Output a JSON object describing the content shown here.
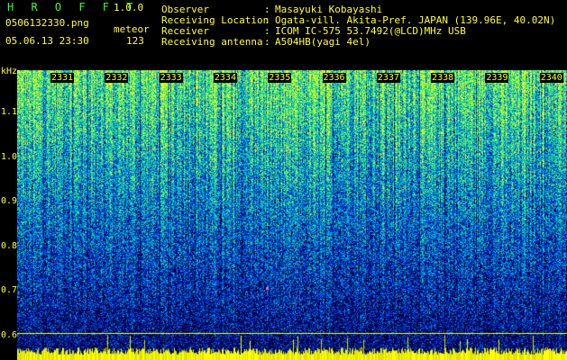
{
  "header": {
    "app_title": "H R O F F T",
    "app_version": "1.0.0",
    "file_name": "0506132330.png",
    "mode": "meteor",
    "date_time": "05.06.13 23:30",
    "count": "123"
  },
  "info": [
    {
      "key": "Observer",
      "value": "Masayuki Kobayashi"
    },
    {
      "key": "Receiving Location",
      "value": "Ogata-vill. Akita-Pref. JAPAN (139.96E, 40.02N)"
    },
    {
      "key": "Receiver",
      "value": "ICOM IC-575 53.7492(@LCD)MHz USB"
    },
    {
      "key": "Receiving antenna",
      "value": "A504HB(yagi 4el)"
    }
  ],
  "axis": {
    "y_unit": "kHz",
    "y_ticks": [
      "1.1",
      "1.0",
      "0.9",
      "0.8",
      "0.7",
      "0.6"
    ],
    "x_ticks": [
      "2331",
      "2332",
      "2333",
      "2334",
      "2335",
      "2336",
      "2337",
      "2338",
      "2339",
      "2340"
    ]
  },
  "colors": {
    "label": "#ffff33",
    "title": "#33ff33",
    "signal_line": "#ffff00"
  }
}
